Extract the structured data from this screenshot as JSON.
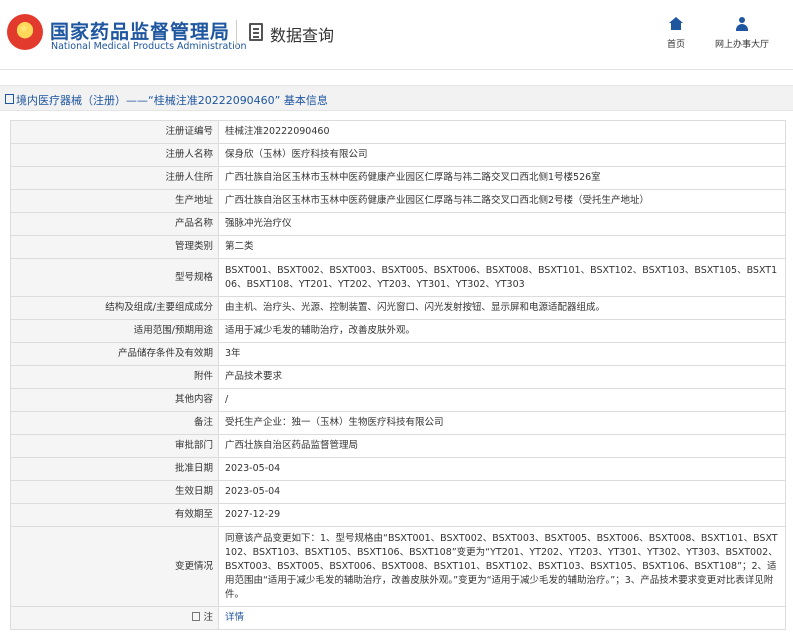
{
  "header": {
    "site_name": "国家药品监督管理局",
    "site_name_en": "National Medical Products Administration",
    "query_title": "数据查询",
    "nav_home": "首页",
    "nav_office": "网上办事大厅",
    "brand_color": "#1e56a0",
    "logo_icon": "national-emblem-icon"
  },
  "breadcrumb": {
    "text": "境内医疗器械（注册）——“桂械注准20222090460” 基本信息"
  },
  "rows": [
    {
      "label": "注册证编号",
      "value": "桂械注准20222090460"
    },
    {
      "label": "注册人名称",
      "value": "保身欣（玉林）医疗科技有限公司"
    },
    {
      "label": "注册人住所",
      "value": "广西壮族自治区玉林市玉林中医药健康产业园区仁厚路与祎二路交叉口西北侧1号楼526室"
    },
    {
      "label": "生产地址",
      "value": "广西壮族自治区玉林市玉林中医药健康产业园区仁厚路与祎二路交叉口西北侧2号楼（受托生产地址）"
    },
    {
      "label": "产品名称",
      "value": "强脉冲光治疗仪"
    },
    {
      "label": "管理类别",
      "value": "第二类"
    },
    {
      "label": "型号规格",
      "value": "BSXT001、BSXT002、BSXT003、BSXT005、BSXT006、BSXT008、BSXT101、BSXT102、BSXT103、BSXT105、BSXT106、BSXT108、YT201、YT202、YT203、YT301、YT302、YT303"
    },
    {
      "label": "结构及组成/主要组成成分",
      "value": "由主机、治疗头、光源、控制装置、闪光窗口、闪光发射按钮、显示屏和电源适配器组成。"
    },
    {
      "label": "适用范围/预期用途",
      "value": "适用于减少毛发的辅助治疗，改善皮肤外观。"
    },
    {
      "label": "产品储存条件及有效期",
      "value": "3年"
    },
    {
      "label": "附件",
      "value": "产品技术要求"
    },
    {
      "label": "其他内容",
      "value": "/"
    },
    {
      "label": "备注",
      "value": "受托生产企业：独一（玉林）生物医疗科技有限公司"
    },
    {
      "label": "审批部门",
      "value": "广西壮族自治区药品监督管理局"
    },
    {
      "label": "批准日期",
      "value": "2023-05-04"
    },
    {
      "label": "生效日期",
      "value": "2023-05-04"
    },
    {
      "label": "有效期至",
      "value": "2027-12-29"
    },
    {
      "label": "变更情况",
      "value": "同意该产品变更如下：1、型号规格由“BSXT001、BSXT002、BSXT003、BSXT005、BSXT006、BSXT008、BSXT101、BSXT102、BSXT103、BSXT105、BSXT106、BSXT108”变更为“YT201、YT202、YT203、YT301、YT302、YT303、BSXT002、BSXT003、BSXT005、BSXT006、BSXT008、BSXT101、BSXT102、BSXT103、BSXT105、BSXT106、BSXT108”；2、适用范围由“适用于减少毛发的辅助治疗，改善皮肤外观。”变更为“适用于减少毛发的辅助治疗。”；3、产品技术要求变更对比表详见附件。"
    }
  ],
  "note_row": {
    "label": "注",
    "link": "详情"
  }
}
